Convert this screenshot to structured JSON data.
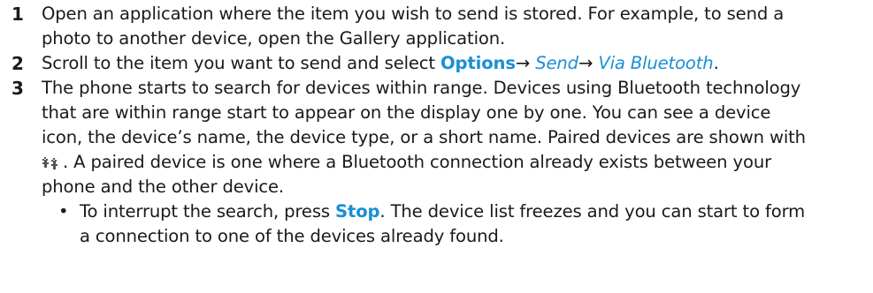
{
  "steps": [
    {
      "number": "1",
      "lines": [
        "Open an application where the item you wish to send is stored. For example, to send a",
        "photo to another device, open the Gallery application."
      ]
    },
    {
      "number": "2",
      "prefix": "Scroll to the item you want to send and select ",
      "keyword": "Options",
      "arrow1": "→ ",
      "menu1": "Send",
      "arrow2": "→ ",
      "menu2": "Via Bluetooth",
      "suffix": "."
    },
    {
      "number": "3",
      "lines": [
        "The phone starts to search for devices within range. Devices using Bluetooth technology",
        "that are within range start to appear on the display one by one. You can see a device",
        "icon, the device’s name, the device type, or a short name. Paired devices are shown with"
      ],
      "line4_suffix": ". A paired device is one where a Bluetooth connection already exists between your",
      "line5": "phone and the other device."
    }
  ],
  "bullet": {
    "dot": "•",
    "prefix": "To interrupt the search, press ",
    "keyword": "Stop",
    "rest": ". The device list freezes and you can start to form",
    "line2": "a connection to one of the devices already found."
  },
  "icons": {
    "paired_devices": "paired-devices-icon"
  },
  "colors": {
    "text": "#1a1a1a",
    "accent": "#1a8fd6"
  }
}
